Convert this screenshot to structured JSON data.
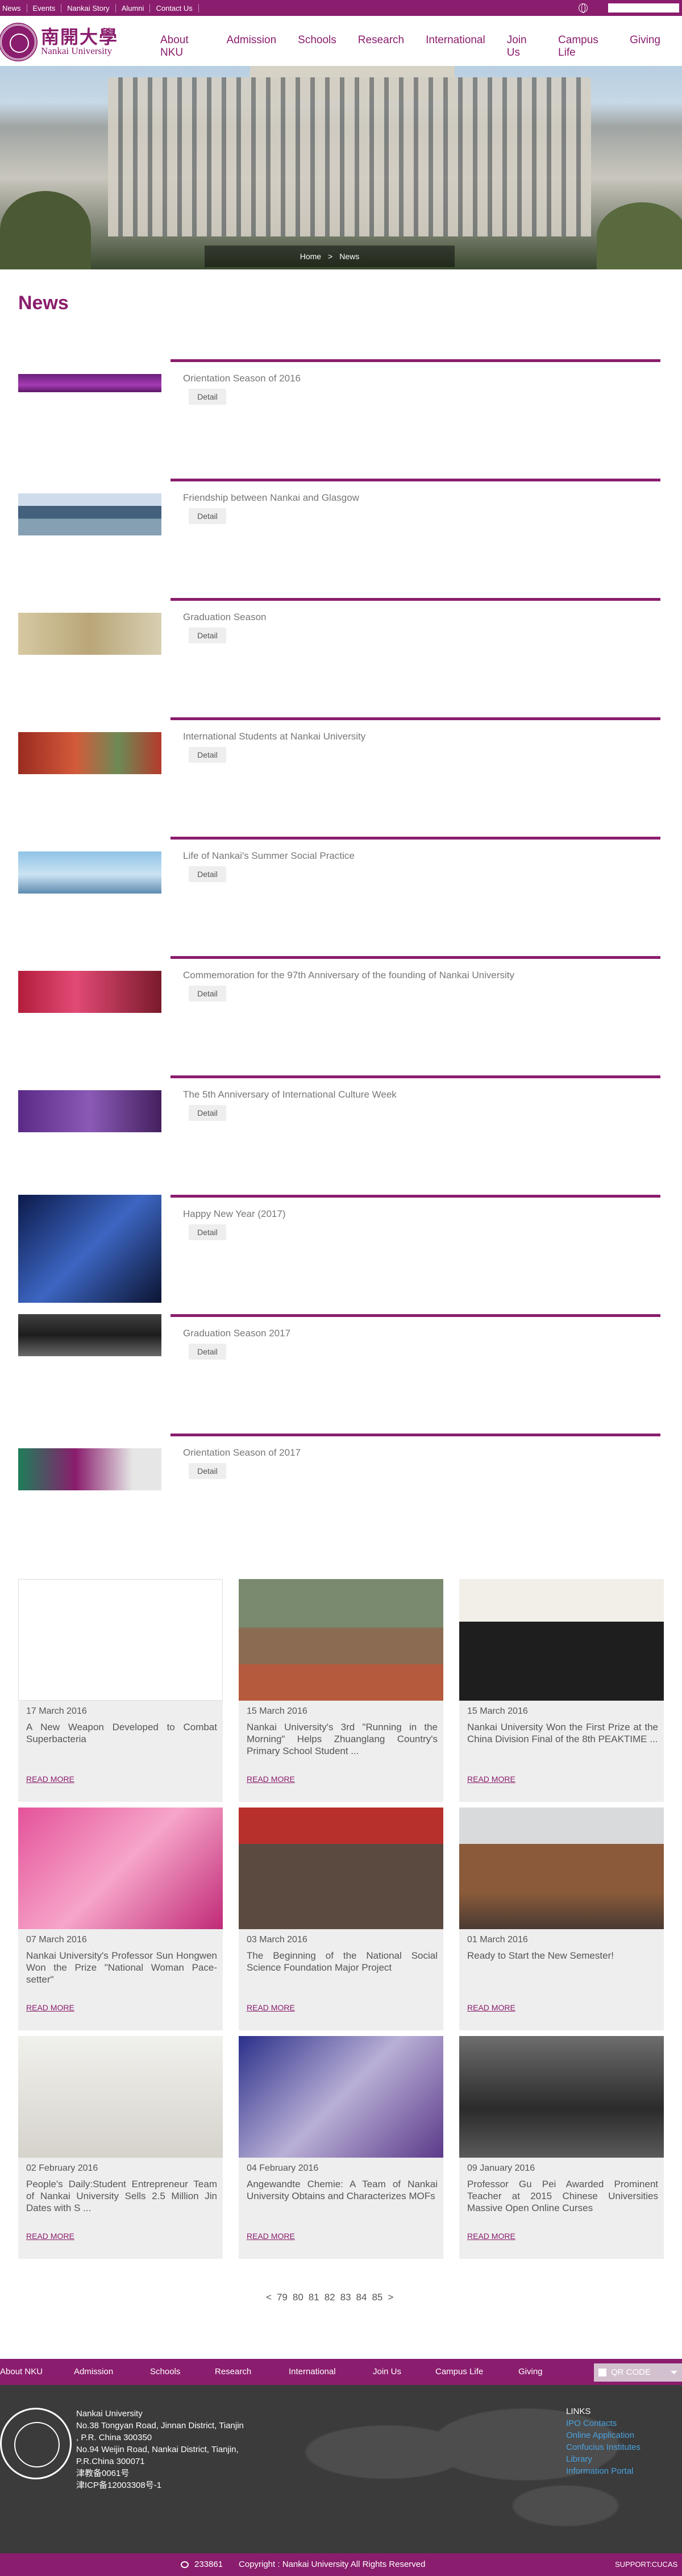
{
  "topbar": {
    "links": [
      "News",
      "Events",
      "Nankai Story",
      "Alumni",
      "Contact Us"
    ]
  },
  "header": {
    "logo_cn": "南開大學",
    "logo_en": "Nankai University",
    "nav": [
      "About NKU",
      "Admission",
      "Schools",
      "Research",
      "International",
      "Join Us",
      "Campus Life",
      "Giving"
    ]
  },
  "breadcrumb": {
    "home": "Home",
    "sep": ">",
    "current": "News"
  },
  "page_title": "News",
  "detail_label": "Detail",
  "news_list": [
    {
      "title": "Orientation Season of 2016",
      "thumb": "purple"
    },
    {
      "title": "Friendship between Nankai and Glasgow",
      "thumb": "blue"
    },
    {
      "title": "Graduation Season",
      "thumb": "gold"
    },
    {
      "title": "International Students at Nankai University",
      "thumb": "red"
    },
    {
      "title": "Life of Nankai's Summer Social Practice",
      "thumb": "sky"
    },
    {
      "title": "Commemoration for the 97th Anniversary of the founding of Nankai University",
      "thumb": "magenta"
    },
    {
      "title": "The 5th Anniversary of International Culture Week",
      "thumb": "violet"
    },
    {
      "title": "Happy New Year (2017)",
      "thumb": "navy"
    },
    {
      "title": "Graduation Season 2017",
      "thumb": "dark"
    },
    {
      "title": "Orientation Season of 2017",
      "thumb": "green"
    }
  ],
  "cards": [
    {
      "date": "17 March 2016",
      "title": "A New Weapon Developed to Combat Superbacteria",
      "read": "READ MORE"
    },
    {
      "date": "15 March 2016",
      "title": "Nankai University's 3rd \"Running in the Morning\" Helps Zhuanglang Country's Primary School Student ...",
      "read": "READ MORE"
    },
    {
      "date": "15 March 2016",
      "title": "Nankai University Won the First Prize at the China Division Final of the 8th PEAKTIME ...",
      "read": "READ MORE"
    },
    {
      "date": "07 March 2016",
      "title": "Nankai University's Professor Sun Hongwen Won the Prize \"National Woman Pace-setter\"",
      "read": "READ MORE"
    },
    {
      "date": "03 March 2016",
      "title": "The Beginning of the National Social Science Foundation Major Project",
      "read": "READ MORE"
    },
    {
      "date": "01 March 2016",
      "title": "Ready to Start the New Semester!",
      "read": "READ MORE"
    },
    {
      "date": "02 February 2016",
      "title": "People's Daily:Student Entrepreneur Team of Nankai University Sells 2.5 Million Jin Dates with S ...",
      "read": "READ MORE"
    },
    {
      "date": "04 February 2016",
      "title": "Angewandte Chemie: A Team of Nankai University Obtains and Characterizes MOFs",
      "read": "READ MORE"
    },
    {
      "date": "09 January 2016",
      "title": "Professor Gu Pei Awarded Prominent Teacher at 2015 Chinese Universities Massive Open Online Curses",
      "read": "READ MORE"
    }
  ],
  "pager": {
    "prev": "<",
    "pages": [
      "79",
      "80",
      "81",
      "82",
      "83",
      "84",
      "85"
    ],
    "next": ">"
  },
  "footer_nav": [
    "About NKU",
    "Admission",
    "Schools",
    "Research",
    "International",
    "Join Us",
    "Campus Life",
    "Giving"
  ],
  "qr_label": "QR CODE",
  "footer_address": [
    "Nankai University",
    "No.38 Tongyan Road, Jinnan District, Tianjin",
    ", P.R. China 300350",
    "No.94 Weijin Road, Nankai District, Tianjin,",
    "P.R.China 300071",
    "津教备0061号",
    "津ICP备12003308号-1"
  ],
  "footer_links": {
    "heading": "LINKS",
    "items": [
      "IPO Contacts",
      "Online Application",
      "Confucius Institutes",
      "Library",
      "Information Portal"
    ]
  },
  "copyright": {
    "count": "233861",
    "text": "Copyright : Nankai University All Rights Reserved",
    "support": "SUPPORT:CUCAS"
  },
  "colors": {
    "brand": "#8a1d6d",
    "link": "#4aa3df",
    "footer_bg": "#3b3b3b"
  }
}
